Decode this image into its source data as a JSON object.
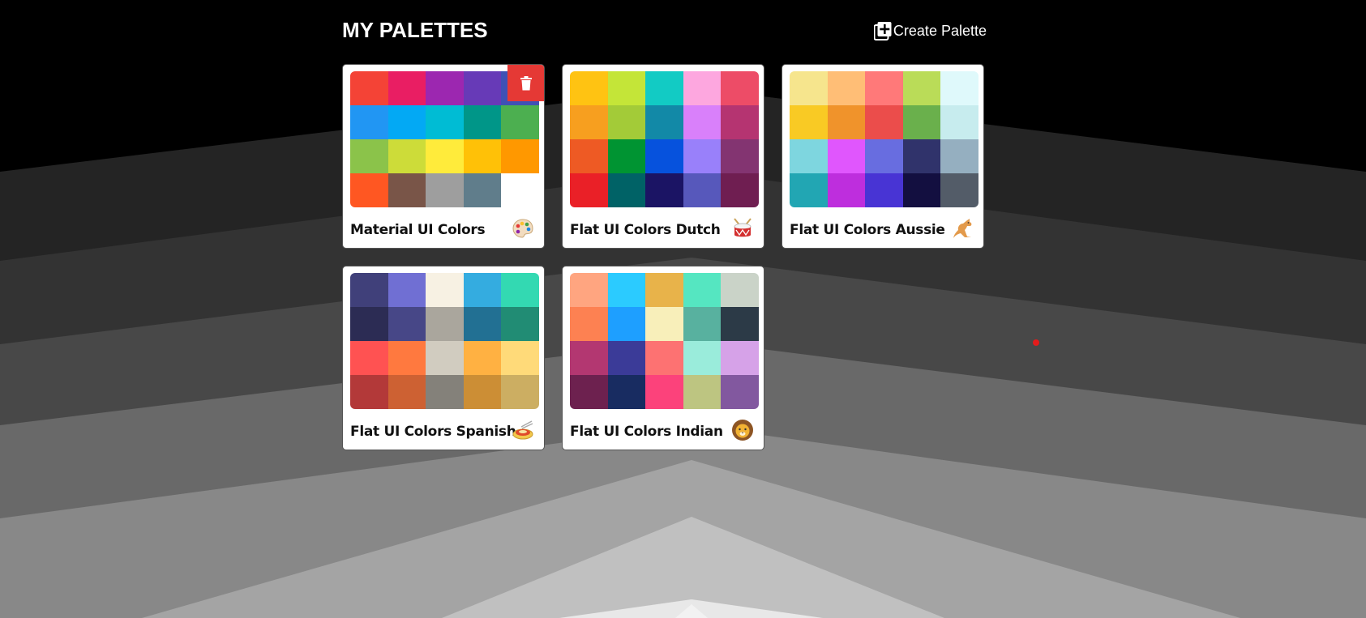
{
  "header": {
    "title": "MY PALETTES",
    "create_label": "Create Palette",
    "create_icon": "add-box-icon"
  },
  "delete_icon": "trash-icon",
  "palettes": [
    {
      "name": "Material UI Colors",
      "emoji": "artist-palette-icon",
      "show_delete": true,
      "colors": [
        "#f44336",
        "#e91e63",
        "#9c27b0",
        "#673ab7",
        "#3f51b5",
        "#2196f3",
        "#03a9f4",
        "#00bcd4",
        "#009688",
        "#4caf50",
        "#8bc34a",
        "#cddc39",
        "#ffeb3b",
        "#ffc107",
        "#ff9800",
        "#ff5722",
        "#795548",
        "#9e9e9e",
        "#607d8b",
        "#ffffff"
      ]
    },
    {
      "name": "Flat UI Colors Dutch",
      "emoji": "drum-icon",
      "colors": [
        "#ffc312",
        "#c4e538",
        "#12cbc4",
        "#fda7df",
        "#ed4c67",
        "#f79f1f",
        "#a3cb38",
        "#1289a7",
        "#d980fa",
        "#b53471",
        "#ee5a24",
        "#009432",
        "#0652dd",
        "#9980fa",
        "#833471",
        "#ea2027",
        "#006266",
        "#1b1464",
        "#5758bb",
        "#6f1e51"
      ]
    },
    {
      "name": "Flat UI Colors Aussie",
      "emoji": "kangaroo-icon",
      "colors": [
        "#f6e58d",
        "#ffbe76",
        "#ff7979",
        "#badc58",
        "#dff9fb",
        "#f9ca24",
        "#f0932b",
        "#eb4d4b",
        "#6ab04c",
        "#c7ecee",
        "#7ed6df",
        "#e056fd",
        "#686de0",
        "#30336b",
        "#95afc0",
        "#22a6b3",
        "#be2edd",
        "#4834d4",
        "#130f40",
        "#535c68"
      ]
    },
    {
      "name": "Flat UI Colors Spanish",
      "emoji": "paella-icon",
      "colors": [
        "#40407a",
        "#706fd3",
        "#f7f1e3",
        "#34ace0",
        "#33d9b2",
        "#2c2c54",
        "#474787",
        "#aaa69d",
        "#227093",
        "#218c74",
        "#ff5252",
        "#ff793f",
        "#d1ccc0",
        "#ffb142",
        "#ffda79",
        "#b33939",
        "#cd6133",
        "#84817a",
        "#cc8e35",
        "#ccae62"
      ]
    },
    {
      "name": "Flat UI Colors Indian",
      "emoji": "lion-icon",
      "colors": [
        "#ffa580",
        "#2bcbff",
        "#e8b34a",
        "#55e6c1",
        "#cad3c8",
        "#fd8152",
        "#1e9fff",
        "#f8efba",
        "#58b19f",
        "#2c3a47",
        "#b33771",
        "#3b3b98",
        "#fd7272",
        "#9aecdb",
        "#d6a2e8",
        "#6d214f",
        "#182c61",
        "#fc427b",
        "#bdc581",
        "#82589f"
      ]
    }
  ]
}
